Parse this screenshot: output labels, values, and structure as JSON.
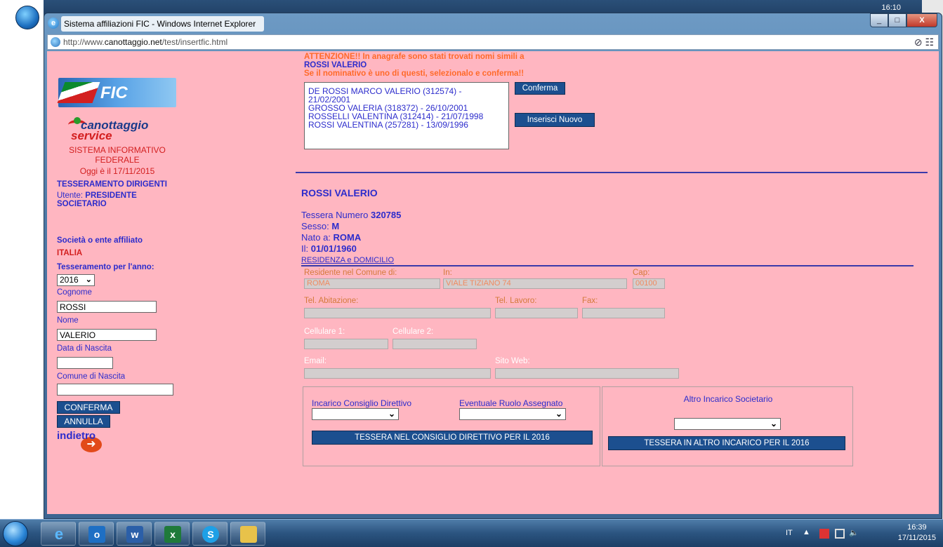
{
  "window": {
    "title": "Sistema affiliazioni FIC - Windows Internet Explorer",
    "url_prefix": "http://www.",
    "url_domain": "canottaggio.net",
    "url_path": "/test/insertfic.html",
    "btn_min": "_",
    "btn_max": "□",
    "btn_close": "X",
    "top_clock": "16:10"
  },
  "sidebar": {
    "fic_logo": "FIC",
    "cs_logo_1": "canottaggio",
    "cs_logo_2": "service",
    "system_line1": "SISTEMA INFORMATIVO",
    "system_line2": "FEDERALE",
    "today": "Oggi è il 17/11/2015",
    "section": "TESSERAMENTO DIRIGENTI",
    "user_label": "Utente: ",
    "user_value": "PRESIDENTE",
    "user_value2": "SOCIETARIO",
    "society_label": "Società o ente affiliato",
    "society_value": "ITALIA",
    "year_label": "Tesseramento per l'anno:",
    "year_value": "2016",
    "cognome_label": "Cognome",
    "cognome_value": "ROSSI",
    "nome_label": "Nome",
    "nome_value": "VALERIO",
    "data_label": "Data di Nascita",
    "data_value": "",
    "comune_label": "Comune di Nascita",
    "comune_value": "",
    "confirm_btn": "CONFERMA",
    "cancel_btn": "ANNULLA",
    "back_link": "indietro"
  },
  "warning": {
    "line1": "ATTENZIONE!! In anagrafe sono stati trovati nomi simili a",
    "name": "ROSSI VALERIO",
    "line2": "Se il nominativo è uno di questi, selezionalo e conferma!!",
    "candidates": [
      "DE ROSSI MARCO VALERIO (312574) - 21/02/2001",
      "GROSSO VALERIA (318372) - 26/10/2001",
      "ROSSELLI VALENTINA (312414) - 21/07/1998",
      "ROSSI VALENTINA (257281) - 13/09/1996"
    ],
    "confirm_btn": "Conferma",
    "new_btn": "Inserisci Nuovo"
  },
  "person": {
    "name": "ROSSI VALERIO",
    "tessera_label": "Tessera Numero ",
    "tessera_value": "320785",
    "sesso_label": "Sesso: ",
    "sesso_value": "M",
    "nato_label": "Nato a: ",
    "nato_value": "ROMA",
    "il_label": "Il: ",
    "il_value": "01/01/1960"
  },
  "residenza": {
    "title": "RESIDENZA e DOMICILIO",
    "comune_label": "Residente nel Comune di:",
    "comune_value": "ROMA",
    "in_label": "In:",
    "in_value": "VIALE TIZIANO 74",
    "cap_label": "Cap:",
    "cap_value": "00100",
    "tel_ab_label": "Tel. Abitazione:",
    "tel_lav_label": "Tel. Lavoro:",
    "fax_label": "Fax:",
    "cell1_label": "Cellulare 1:",
    "cell2_label": "Cellulare 2:",
    "email_label": "Email:",
    "web_label": "Sito Web:"
  },
  "incarichi": {
    "consiglio_label": "Incarico Consiglio Direttivo",
    "ruolo_label": "Eventuale Ruolo Assegnato",
    "altro_label": "Altro Incarico Societario",
    "btn_consiglio": "TESSERA NEL CONSIGLIO DIRETTIVO PER IL 2016",
    "btn_altro": "TESSERA IN ALTRO INCARICO PER IL 2016"
  },
  "taskbar": {
    "lang": "IT",
    "time": "16:39",
    "date": "17/11/2015",
    "apps": [
      "ie-icon",
      "outlook-icon",
      "word-icon",
      "excel-icon",
      "skype-icon",
      "explorer-icon"
    ]
  }
}
